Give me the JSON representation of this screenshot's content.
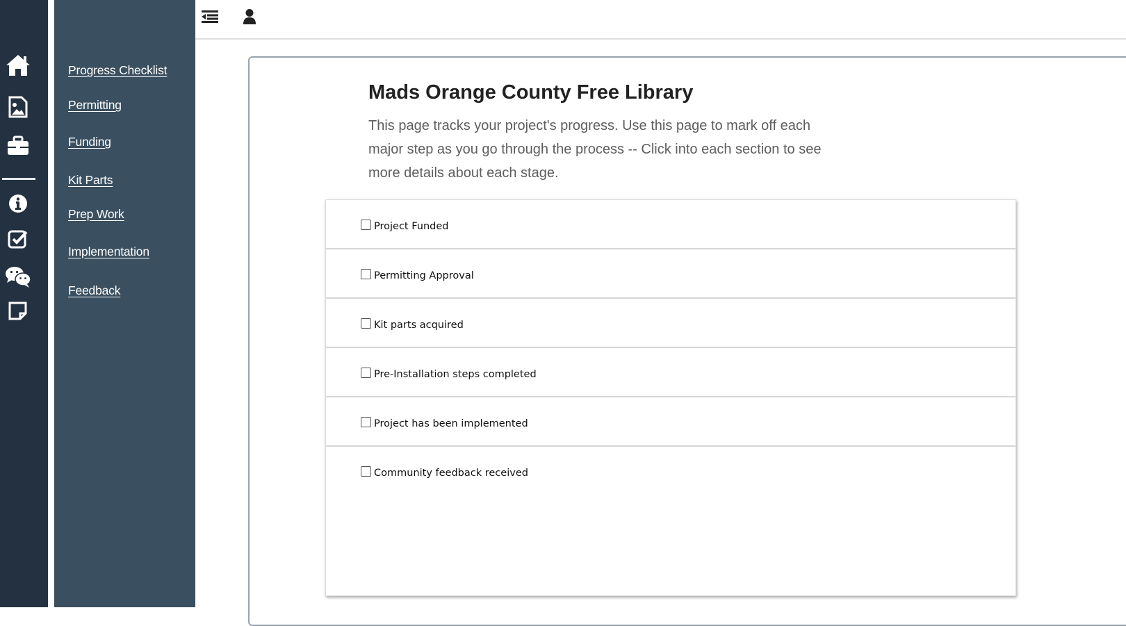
{
  "rail": {
    "icons": [
      "home-icon",
      "image-file-icon",
      "briefcase-icon",
      "info-icon",
      "checkbox-icon",
      "chat-bubbles-icon",
      "sticky-note-icon"
    ]
  },
  "nav": {
    "items": [
      {
        "label": "Progress Checklist"
      },
      {
        "label": "Permitting"
      },
      {
        "label": "Funding"
      },
      {
        "label": "Kit Parts"
      },
      {
        "label": "Prep Work"
      },
      {
        "label": "Implementation"
      },
      {
        "label": "Feedback"
      }
    ]
  },
  "topbar": {
    "icons": [
      "menu-collapse-icon",
      "user-icon"
    ]
  },
  "main": {
    "title": "Mads Orange County Free Library",
    "description": "This page tracks your project's progress. Use this page to mark off each major step as you go through the process -- Click into each section to see more details about each stage."
  },
  "checklist": {
    "items": [
      {
        "label": "Project Funded",
        "checked": false
      },
      {
        "label": "Permitting Approval",
        "checked": false
      },
      {
        "label": "Kit parts acquired",
        "checked": false
      },
      {
        "label": "Pre-Installation steps completed",
        "checked": false
      },
      {
        "label": "Project has been implemented",
        "checked": false
      },
      {
        "label": "Community feedback received",
        "checked": false
      }
    ]
  },
  "colors": {
    "rail": "#233140",
    "nav_panel": "#3a4f5f",
    "title": "#222222",
    "description": "#5e5e5e"
  }
}
